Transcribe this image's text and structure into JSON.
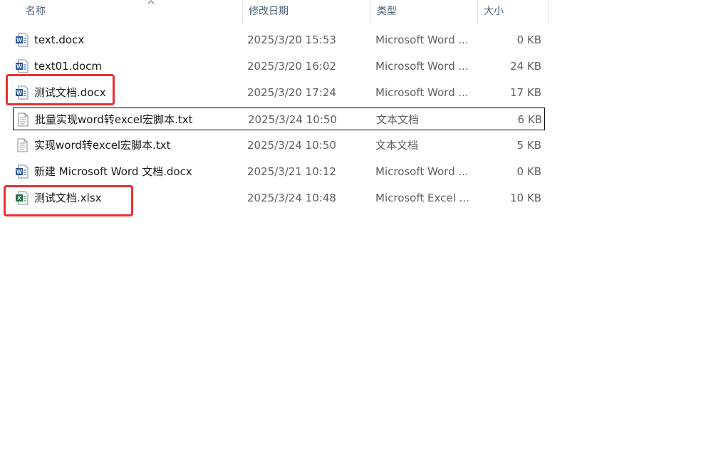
{
  "columns": {
    "name": "名称",
    "date": "修改日期",
    "type": "类型",
    "size": "大小"
  },
  "files": [
    {
      "name": "text.docx",
      "date": "2025/3/20 15:53",
      "type": "Microsoft Word ...",
      "size": "0 KB",
      "icon": "word-doc-icon"
    },
    {
      "name": "text01.docm",
      "date": "2025/3/20 16:02",
      "type": "Microsoft Word ...",
      "size": "24 KB",
      "icon": "word-doc-icon"
    },
    {
      "name": "测试文档.docx",
      "date": "2025/3/20 17:24",
      "type": "Microsoft Word ...",
      "size": "17 KB",
      "icon": "word-doc-icon"
    },
    {
      "name": "批量实现word转excel宏脚本.txt",
      "date": "2025/3/24 10:50",
      "type": "文本文档",
      "size": "6 KB",
      "icon": "text-file-icon"
    },
    {
      "name": "实现word转excel宏脚本.txt",
      "date": "2025/3/24 10:50",
      "type": "文本文档",
      "size": "5 KB",
      "icon": "text-file-icon"
    },
    {
      "name": "新建 Microsoft Word 文档.docx",
      "date": "2025/3/21 10:12",
      "type": "Microsoft Word ...",
      "size": "0 KB",
      "icon": "word-doc-icon"
    },
    {
      "name": "测试文档.xlsx",
      "date": "2025/3/24 10:48",
      "type": "Microsoft Excel ...",
      "size": "10 KB",
      "icon": "excel-doc-icon"
    }
  ],
  "colors": {
    "highlight": "#e8302f",
    "word": "#2b579a",
    "excel": "#217346",
    "header_text": "#4c607a"
  }
}
